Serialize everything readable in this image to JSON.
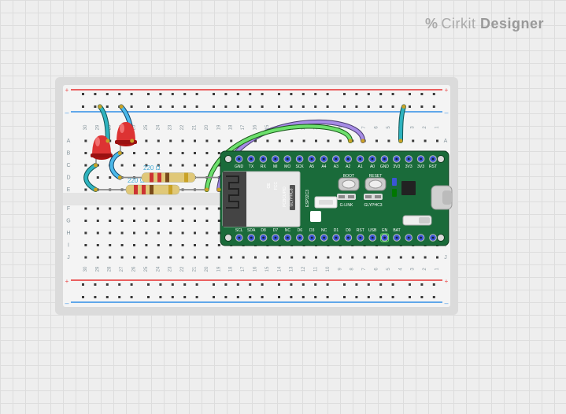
{
  "brand": {
    "glyph": "%",
    "name": "Cirkit",
    "designer": "Designer"
  },
  "breadboard": {
    "columns": [
      "1",
      "2",
      "3",
      "4",
      "5",
      "6",
      "7",
      "8",
      "9",
      "10",
      "11",
      "12",
      "13",
      "14",
      "15",
      "16",
      "17",
      "18",
      "19",
      "20",
      "21",
      "22",
      "23",
      "24",
      "25",
      "26",
      "27",
      "28",
      "29",
      "30"
    ],
    "rowsTop": [
      "A",
      "B",
      "C",
      "D",
      "E"
    ],
    "rowsBot": [
      "F",
      "G",
      "H",
      "I",
      "J"
    ]
  },
  "resistors": {
    "r1": {
      "label": "220 Ω"
    },
    "r2": {
      "label": "220 Ω"
    }
  },
  "mcu": {
    "topPins": [
      "RST",
      "3V3",
      "3V3",
      "3V3",
      "GND",
      "A0",
      "A1",
      "A2",
      "A3",
      "A4",
      "A5",
      "SCK",
      "MO",
      "MI",
      "RX",
      "TX",
      "GND"
    ],
    "botPins": [
      "BAT",
      "EN",
      "USB",
      "RST",
      "D0",
      "D1",
      "NC",
      "D3",
      "D6",
      "NC",
      "D7",
      "D8",
      "SDA",
      "SCL"
    ],
    "silk": {
      "fcc": "FCC",
      "ce": "CE",
      "brand": "PCBCUPID",
      "glyphc": "GLYPHC3",
      "c3": "ESP32C3",
      "logo": "PC",
      "reset": "RESET",
      "boot": "BOOT"
    },
    "jumpers": {
      "glink": "G-LINK",
      "glyphc3": "GLYPHC3"
    }
  },
  "colors": {
    "pcb": "#1a6b3a",
    "railRed": "#e94b4b",
    "railBlue": "#4b9ce9",
    "wireTeal": "#2fb3bf",
    "wireBlue": "#4bb8e9",
    "wirePurple": "#a68be6",
    "wireGreen": "#6ce06c",
    "ledRed": "#d33",
    "pad": "#3b55d4"
  }
}
